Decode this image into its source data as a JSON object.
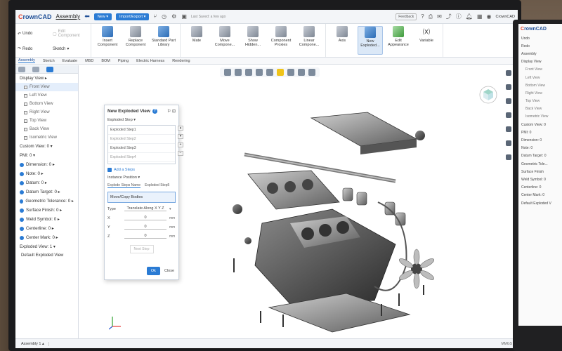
{
  "app": {
    "name_prefix": "C",
    "name_rest": "rownCAD",
    "document_title": "Assembly"
  },
  "titlebar": {
    "new_label": "New ▾",
    "import_export_label": "Import/Export ▾",
    "saved_label": "Last Saved: a few ago",
    "feedback_label": "Feedback",
    "user_label": "CrownCAD"
  },
  "ribbon": {
    "undo": "Undo",
    "redo": "Redo",
    "edit_component": "Edit Component",
    "sketch": "Sketch",
    "items": [
      {
        "label": "Insert Component",
        "icon": "insert-component-icon"
      },
      {
        "label": "Replace Component",
        "icon": "replace-component-icon"
      },
      {
        "label": "Standard Part Library",
        "icon": "standard-part-library-icon"
      },
      {
        "label": "Mate",
        "icon": "mate-icon"
      },
      {
        "label": "Move Compone...",
        "icon": "move-component-icon"
      },
      {
        "label": "Show Hidden...",
        "icon": "show-hidden-icon"
      },
      {
        "label": "Component Proxies",
        "icon": "component-proxies-icon"
      },
      {
        "label": "Linear Compone...",
        "icon": "linear-component-icon"
      },
      {
        "label": "Axis",
        "icon": "axis-icon"
      },
      {
        "label": "New Exploded...",
        "icon": "new-exploded-icon"
      },
      {
        "label": "Edit Appearance",
        "icon": "edit-appearance-icon"
      },
      {
        "label": "Variable",
        "icon": "variable-icon"
      }
    ]
  },
  "tabs": [
    "Assembly",
    "Sketch",
    "Evaluate",
    "MBD",
    "BOM",
    "Piping",
    "Electric Harness",
    "Rendering"
  ],
  "left_panel": {
    "display_view": "Display View ▸",
    "views": [
      "Front View",
      "Left View",
      "Bottom View",
      "Right View",
      "Top View",
      "Back View",
      "Isometric View"
    ],
    "custom_view": "Custom View: 0 ▾",
    "pmi": "PMI: 0 ▾",
    "pmi_items": [
      {
        "label": "Dimension: 0 ▸",
        "color": "#2a7bd4"
      },
      {
        "label": "Note: 0 ▸",
        "color": "#2a7bd4"
      },
      {
        "label": "Datum: 0 ▸",
        "color": "#2a7bd4"
      },
      {
        "label": "Datum Target: 0 ▸",
        "color": "#2a7bd4"
      },
      {
        "label": "Geometric Tolerance: 0 ▸",
        "color": "#2a7bd4"
      },
      {
        "label": "Surface Finish: 0 ▸",
        "color": "#2a7bd4"
      },
      {
        "label": "Weld Symbol: 0 ▸",
        "color": "#2a7bd4"
      },
      {
        "label": "Centerline: 0 ▸",
        "color": "#2a7bd4"
      },
      {
        "label": "Center Mark: 0 ▸",
        "color": "#2a7bd4"
      }
    ],
    "exploded_view": "Exploded View: 1 ▾",
    "default_exploded": "Default Exploded View"
  },
  "dialog": {
    "title": "New Exploded View",
    "controls": "⚐ ⊡",
    "section": "Exploded Step ▾",
    "steps": [
      "Exploded Step1",
      "Exploded Step2",
      "Exploded Step3",
      "Exploded Step4"
    ],
    "add_steps": "Add a Steps",
    "instance_position": "Instance Position ▾",
    "tab1": "Explode Steps Name",
    "tab2": "Exploded Step5",
    "move_copy": "Move/Copy Bodies",
    "type_label": "Type",
    "type_value": "Translate Along X Y Z",
    "fields": [
      {
        "label": "X",
        "value": "0",
        "unit": "mm"
      },
      {
        "label": "Y",
        "value": "0",
        "unit": "mm"
      },
      {
        "label": "Z",
        "value": "0",
        "unit": "mm"
      }
    ],
    "next_step": "Next Step",
    "ok": "Ok",
    "close": "Close"
  },
  "status": {
    "tab_label": "Assembly 1 ▴",
    "units": "MMGS"
  },
  "second_monitor": {
    "logo_c": "C",
    "logo_rest": "rownCAD",
    "rows": [
      "Undo",
      "Redo",
      "Assembly",
      "Display View",
      "Front View",
      "Left View",
      "Bottom View",
      "Right View",
      "Top View",
      "Back View",
      "Isometric View",
      "Custom View: 0",
      "PMI: 0",
      "Dimension: 0",
      "Note: 0",
      "Datum Target: 0",
      "Geometric Tole...",
      "Surface Finish",
      "Weld Symbol: 0",
      "Centerline: 0",
      "Center Mark: 0",
      "Default Exploded V"
    ]
  }
}
